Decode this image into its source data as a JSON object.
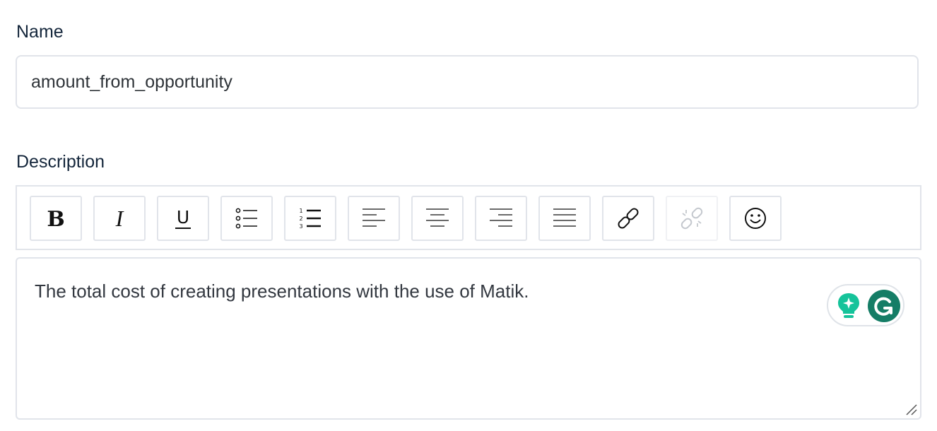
{
  "name_field": {
    "label": "Name",
    "value": "amount_from_opportunity"
  },
  "description_field": {
    "label": "Description",
    "text": "The total cost of creating presentations with the use of Matik."
  },
  "toolbar": {
    "buttons": [
      {
        "icon": "bold-icon",
        "enabled": true
      },
      {
        "icon": "italic-icon",
        "enabled": true
      },
      {
        "icon": "underline-icon",
        "enabled": true
      },
      {
        "icon": "bulleted-list-icon",
        "enabled": true
      },
      {
        "icon": "numbered-list-icon",
        "enabled": true
      },
      {
        "icon": "align-left-icon",
        "enabled": true
      },
      {
        "icon": "align-center-icon",
        "enabled": true
      },
      {
        "icon": "align-right-icon",
        "enabled": true
      },
      {
        "icon": "align-justify-icon",
        "enabled": true
      },
      {
        "icon": "link-icon",
        "enabled": true
      },
      {
        "icon": "unlink-icon",
        "enabled": false
      },
      {
        "icon": "emoji-icon",
        "enabled": true
      }
    ],
    "glyphs": {
      "bold": "B",
      "italic": "I",
      "underline": "U",
      "numbers": [
        "1",
        "2",
        "3"
      ]
    }
  },
  "grammarly_widget": {
    "icons": [
      "lightbulb-sparkle-icon",
      "grammarly-logo-icon"
    ],
    "colors": {
      "bulb": "#15c39a",
      "logo": "#157d66"
    }
  },
  "colors": {
    "label_text": "#14263b",
    "border": "#e1e4ea",
    "body_text": "#333840"
  }
}
